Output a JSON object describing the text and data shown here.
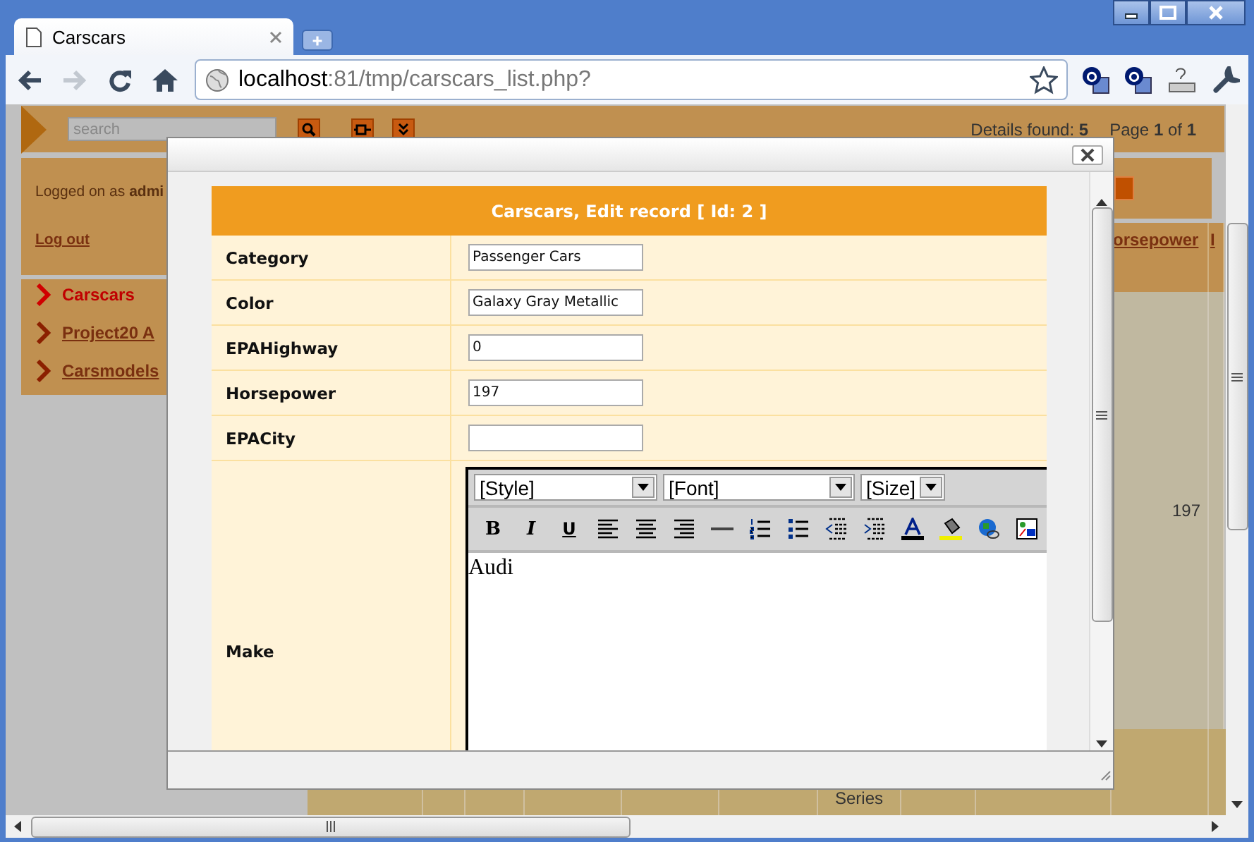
{
  "browser": {
    "tab_title": "Carscars",
    "address_host": "localhost",
    "address_path": ":81/tmp/carscars_list.php?"
  },
  "page": {
    "search": {
      "placeholder": "search"
    },
    "details": "Details found: **5**",
    "pagination": "Page **1** of **1**",
    "logged_on": "Logged on as **admi**",
    "logout": "Log out",
    "menu": [
      {
        "label": "Carscars",
        "selected": true
      },
      {
        "label": "Project20 A",
        "selected": false
      },
      {
        "label": "Carsmodels",
        "selected": false
      }
    ],
    "grid": {
      "column_header": "orsepower",
      "column_header_2": "I",
      "horsepower_cell": "197",
      "description_cell": "Series"
    }
  },
  "modal": {
    "title": "Carscars, Edit record [ Id: 2 ]",
    "fields": [
      {
        "label": "Category",
        "kind": "input",
        "value": "Passenger Cars"
      },
      {
        "label": "Color",
        "kind": "input",
        "value": "Galaxy Gray Metallic"
      },
      {
        "label": "EPAHighway",
        "kind": "input",
        "value": "0"
      },
      {
        "label": "Horsepower",
        "kind": "input",
        "value": "197"
      },
      {
        "label": "EPACity",
        "kind": "input"
      },
      {
        "label": "Make",
        "kind": "editor",
        "value": "Audi"
      }
    ],
    "editor": {
      "selects": [
        "[Style]",
        "[Font]",
        "[Size]"
      ],
      "format_buttons": [
        "B",
        "I",
        "U"
      ]
    }
  }
}
